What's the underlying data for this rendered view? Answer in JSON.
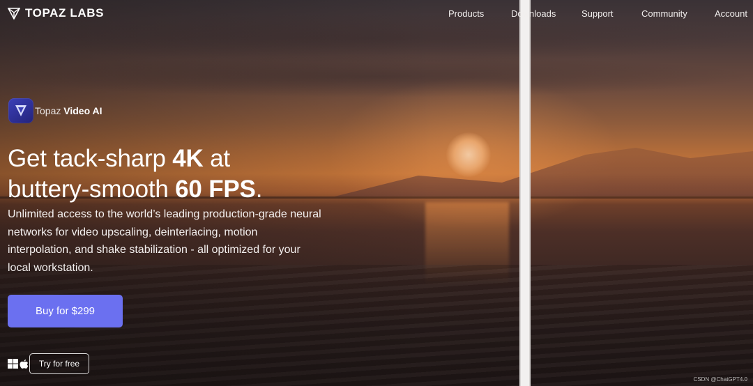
{
  "nav": {
    "brand": "TOPAZ LABS",
    "links": [
      {
        "label": "Products"
      },
      {
        "label": "Downloads"
      },
      {
        "label": "Support"
      },
      {
        "label": "Community"
      },
      {
        "label": "Account"
      }
    ]
  },
  "product": {
    "name_light": "Topaz",
    "name_bold": "Video AI",
    "icon": "play-triangle-icon"
  },
  "hero": {
    "headline_part1": "Get tack-sharp ",
    "headline_bold1": "4K",
    "headline_part2": " at",
    "headline_part3": "buttery-smooth ",
    "headline_bold2": "60 FPS",
    "headline_part4": ".",
    "subtext": "Unlimited access to the world’s leading production-grade neural networks for video upscaling, deinterlacing, motion interpolation, and shake stabilization - all optimized for your local workstation."
  },
  "cta": {
    "buy_label": "Buy for $299",
    "try_label": "Try for free",
    "os_icons": [
      "windows-icon",
      "apple-icon"
    ]
  },
  "watermark": "CSDN @ChatGPT4.0",
  "colors": {
    "accent": "#6b70f0",
    "product_icon": "#3b3fb8"
  }
}
